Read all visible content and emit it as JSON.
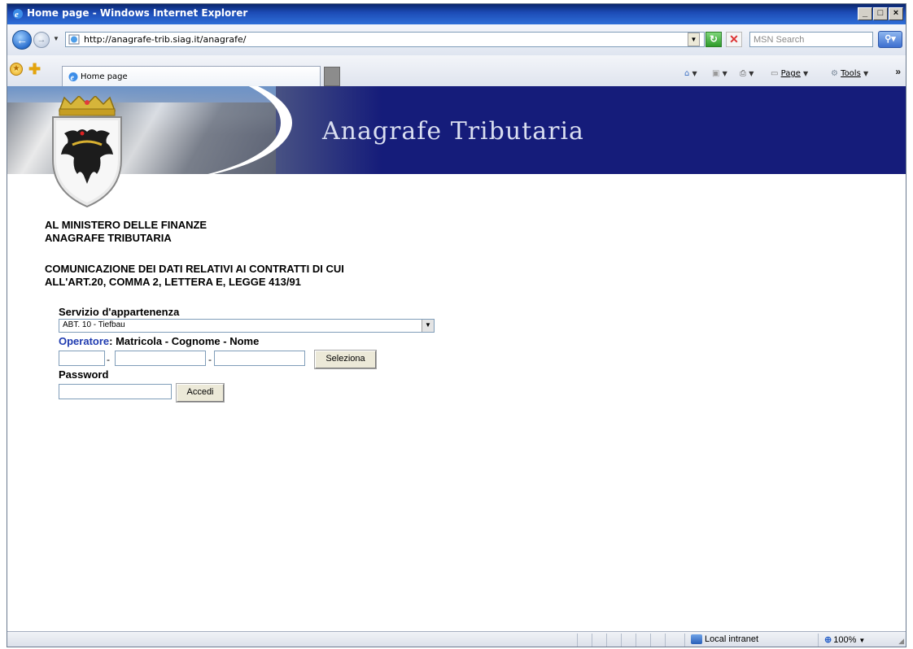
{
  "window": {
    "title": "Home page - Windows Internet Explorer",
    "minimize": "_",
    "maximize": "□",
    "close": "×"
  },
  "address_bar": {
    "url": "http://anagrafe-trib.siag.it/anagrafe/",
    "search_placeholder": "MSN Search"
  },
  "tab_bar": {
    "tab_label": "Home page",
    "page_menu": "Page",
    "tools_menu": "Tools"
  },
  "page": {
    "banner_title": "Anagrafe Tributaria",
    "header_line1": "AL MINISTERO DELLE FINANZE",
    "header_line2": "ANAGRAFE TRIBUTARIA",
    "subject_line1": "COMUNICAZIONE DEI DATI RELATIVI AI CONTRATTI DI CUI",
    "subject_line2": "ALL'ART.20, COMMA 2, LETTERA E, LEGGE 413/91",
    "service_label": "Servizio d'appartenenza",
    "service_value": "ABT. 10 - Tiefbau",
    "operator_label_accent": "Operatore",
    "operator_label_rest": ": Matricola - Cognome - Nome",
    "select_button": "Seleziona",
    "password_label": "Password",
    "login_button": "Accedi",
    "matricola_value": "",
    "cognome_value": "",
    "nome_value": "",
    "password_value": ""
  },
  "status_bar": {
    "zone": "Local intranet",
    "zoom": "100%"
  },
  "colors": {
    "banner_blue": "#151c7a",
    "operator_blue": "#1f3bb0"
  }
}
